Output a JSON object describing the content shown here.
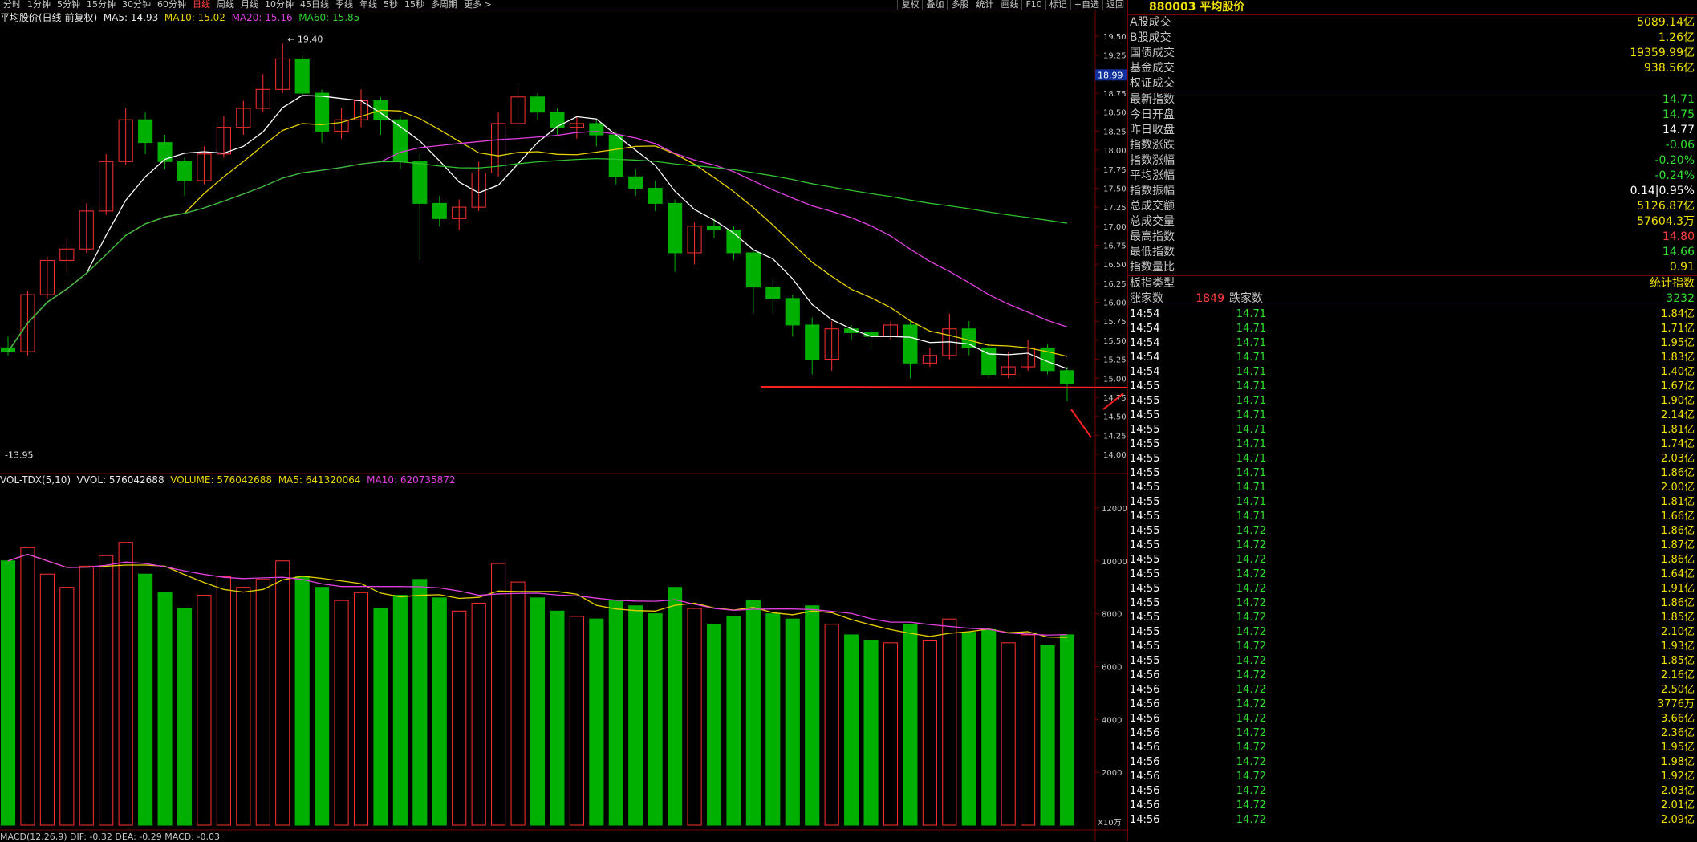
{
  "toolbar": {
    "periods": [
      "分时",
      "1分钟",
      "5分钟",
      "15分钟",
      "30分钟",
      "60分钟",
      "日线",
      "周线",
      "月线",
      "10分钟",
      "45日线",
      "季线",
      "年线",
      "5秒",
      "15秒",
      "多周期",
      "更多 >"
    ],
    "active_period": "日线",
    "tools": [
      "复权",
      "叠加",
      "多股",
      "统计",
      "画线",
      "F10",
      "标记",
      "+自选",
      "返回"
    ]
  },
  "main_chart": {
    "title": "平均股价(日线 前复权)",
    "ma5": "MA5: 14.93",
    "ma10": "MA10: 15.02",
    "ma20": "MA20: 15.16",
    "ma60": "MA60: 15.85",
    "price_axis": [
      "19.50",
      "19.25",
      "19.00",
      "18.75",
      "18.50",
      "18.25",
      "18.00",
      "17.75",
      "17.50",
      "17.25",
      "17.00",
      "16.75",
      "16.50",
      "16.25",
      "16.00",
      "15.75",
      "15.50",
      "15.25",
      "15.00",
      "14.75",
      "14.50",
      "14.25",
      "14.00"
    ],
    "high_label": "19.40",
    "low_label": "13.95",
    "current_tag": "18.99"
  },
  "volume_chart": {
    "legend_name": "VOL-TDX(5,10)",
    "vvol": "VVOL: 576042688",
    "volume": "VOLUME: 576042688",
    "ma5": "MA5: 641320064",
    "ma10": "MA10: 620735872",
    "axis": [
      "12000",
      "10000",
      "8000",
      "6000",
      "4000",
      "2000"
    ],
    "unit": "X10万"
  },
  "macd_legend": "MACD(12,26,9) DIF: -0.32 DEA: -0.29 MACD: -0.03",
  "colors": {
    "up": "#ff3030",
    "down": "#00b000",
    "ma5": "#ffffff",
    "ma10": "#e6d000",
    "ma20": "#e040e0",
    "ma60": "#30c030",
    "grid": "#7a0000"
  },
  "quote_panel": {
    "title": "880003 平均股价",
    "rows1": [
      {
        "label": "A股成交",
        "value": "5089.14亿"
      },
      {
        "label": "B股成交",
        "value": "1.26亿"
      },
      {
        "label": "国债成交",
        "value": "19359.99亿"
      },
      {
        "label": "基金成交",
        "value": "938.56亿"
      },
      {
        "label": "权证成交",
        "value": ""
      }
    ],
    "rows2": [
      {
        "label": "最新指数",
        "value": "14.71",
        "cls": "green"
      },
      {
        "label": "今日开盘",
        "value": "14.75",
        "cls": "green"
      },
      {
        "label": "昨日收盘",
        "value": "14.77",
        "cls": "white"
      },
      {
        "label": "指数涨跌",
        "value": "-0.06",
        "cls": "green"
      },
      {
        "label": "指数涨幅",
        "value": "-0.20%",
        "cls": "green"
      },
      {
        "label": "平均涨幅",
        "value": "-0.24%",
        "cls": "green"
      },
      {
        "label": "指数振幅",
        "value": "0.14|0.95%",
        "cls": "white"
      },
      {
        "label": "总成交额",
        "value": "5126.87亿"
      },
      {
        "label": "总成交量",
        "value": "57604.3万"
      },
      {
        "label": "最高指数",
        "value": "14.80",
        "cls": "red"
      },
      {
        "label": "最低指数",
        "value": "14.66",
        "cls": "green"
      },
      {
        "label": "指数量比",
        "value": "0.91"
      }
    ],
    "type_label": "板指类型",
    "type_value": "统计指数",
    "up_label": "涨家数",
    "up_value": "1849",
    "down_label": "跌家数",
    "down_value": "3232",
    "ticks": [
      {
        "t": "14:54",
        "p": "14.71",
        "v": "1.84亿"
      },
      {
        "t": "14:54",
        "p": "14.71",
        "v": "1.71亿"
      },
      {
        "t": "14:54",
        "p": "14.71",
        "v": "1.95亿"
      },
      {
        "t": "14:54",
        "p": "14.71",
        "v": "1.83亿"
      },
      {
        "t": "14:54",
        "p": "14.71",
        "v": "1.40亿"
      },
      {
        "t": "14:55",
        "p": "14.71",
        "v": "1.67亿"
      },
      {
        "t": "14:55",
        "p": "14.71",
        "v": "1.90亿"
      },
      {
        "t": "14:55",
        "p": "14.71",
        "v": "2.14亿"
      },
      {
        "t": "14:55",
        "p": "14.71",
        "v": "1.81亿"
      },
      {
        "t": "14:55",
        "p": "14.71",
        "v": "1.74亿"
      },
      {
        "t": "14:55",
        "p": "14.71",
        "v": "2.03亿"
      },
      {
        "t": "14:55",
        "p": "14.71",
        "v": "1.86亿"
      },
      {
        "t": "14:55",
        "p": "14.71",
        "v": "2.00亿"
      },
      {
        "t": "14:55",
        "p": "14.71",
        "v": "1.81亿"
      },
      {
        "t": "14:55",
        "p": "14.71",
        "v": "1.66亿"
      },
      {
        "t": "14:55",
        "p": "14.72",
        "v": "1.86亿"
      },
      {
        "t": "14:55",
        "p": "14.72",
        "v": "1.87亿"
      },
      {
        "t": "14:55",
        "p": "14.72",
        "v": "1.86亿"
      },
      {
        "t": "14:55",
        "p": "14.72",
        "v": "1.64亿"
      },
      {
        "t": "14:55",
        "p": "14.72",
        "v": "1.91亿"
      },
      {
        "t": "14:55",
        "p": "14.72",
        "v": "1.86亿"
      },
      {
        "t": "14:55",
        "p": "14.72",
        "v": "1.85亿"
      },
      {
        "t": "14:55",
        "p": "14.72",
        "v": "2.10亿"
      },
      {
        "t": "14:55",
        "p": "14.72",
        "v": "1.93亿"
      },
      {
        "t": "14:55",
        "p": "14.72",
        "v": "1.85亿"
      },
      {
        "t": "14:56",
        "p": "14.72",
        "v": "2.16亿"
      },
      {
        "t": "14:56",
        "p": "14.72",
        "v": "2.50亿"
      },
      {
        "t": "14:56",
        "p": "14.72",
        "v": "3776万"
      },
      {
        "t": "14:56",
        "p": "14.72",
        "v": "3.66亿"
      },
      {
        "t": "14:56",
        "p": "14.72",
        "v": "2.36亿"
      },
      {
        "t": "14:56",
        "p": "14.72",
        "v": "1.95亿"
      },
      {
        "t": "14:56",
        "p": "14.72",
        "v": "1.98亿"
      },
      {
        "t": "14:56",
        "p": "14.72",
        "v": "1.92亿"
      },
      {
        "t": "14:56",
        "p": "14.72",
        "v": "2.03亿"
      },
      {
        "t": "14:56",
        "p": "14.72",
        "v": "2.01亿"
      },
      {
        "t": "14:56",
        "p": "14.72",
        "v": "2.09亿"
      }
    ]
  },
  "candles": [
    [
      15.4,
      15.35,
      15.55,
      15.3,
      1000
    ],
    [
      15.35,
      16.1,
      16.15,
      15.3,
      1050
    ],
    [
      16.1,
      16.55,
      16.6,
      16.05,
      950
    ],
    [
      16.55,
      16.7,
      16.85,
      16.4,
      900
    ],
    [
      16.7,
      17.2,
      17.3,
      16.65,
      980
    ],
    [
      17.2,
      17.85,
      17.95,
      17.15,
      1020
    ],
    [
      17.85,
      18.4,
      18.55,
      17.8,
      1070
    ],
    [
      18.4,
      18.1,
      18.5,
      17.95,
      950
    ],
    [
      18.1,
      17.85,
      18.2,
      17.75,
      880
    ],
    [
      17.85,
      17.6,
      17.9,
      17.4,
      820
    ],
    [
      17.6,
      17.95,
      18.05,
      17.55,
      870
    ],
    [
      17.95,
      18.3,
      18.45,
      17.9,
      940
    ],
    [
      18.3,
      18.55,
      18.65,
      18.2,
      900
    ],
    [
      18.55,
      18.8,
      19.0,
      18.5,
      930
    ],
    [
      18.8,
      19.2,
      19.4,
      18.75,
      1000
    ],
    [
      19.2,
      18.75,
      19.25,
      18.7,
      940
    ],
    [
      18.75,
      18.25,
      18.8,
      18.1,
      900
    ],
    [
      18.25,
      18.4,
      18.55,
      18.15,
      850
    ],
    [
      18.4,
      18.65,
      18.8,
      18.3,
      880
    ],
    [
      18.65,
      18.4,
      18.7,
      18.2,
      820
    ],
    [
      18.4,
      17.85,
      18.45,
      17.75,
      870
    ],
    [
      17.85,
      17.3,
      17.95,
      16.55,
      930
    ],
    [
      17.3,
      17.1,
      17.4,
      17.0,
      860
    ],
    [
      17.1,
      17.25,
      17.35,
      16.95,
      810
    ],
    [
      17.25,
      17.7,
      17.85,
      17.2,
      840
    ],
    [
      17.7,
      18.35,
      18.5,
      17.65,
      990
    ],
    [
      18.35,
      18.7,
      18.8,
      18.25,
      920
    ],
    [
      18.7,
      18.5,
      18.75,
      18.4,
      860
    ],
    [
      18.5,
      18.3,
      18.55,
      18.2,
      810
    ],
    [
      18.3,
      18.35,
      18.45,
      18.15,
      790
    ],
    [
      18.35,
      18.2,
      18.4,
      18.05,
      780
    ],
    [
      18.2,
      17.65,
      18.25,
      17.55,
      850
    ],
    [
      17.65,
      17.5,
      17.75,
      17.4,
      830
    ],
    [
      17.5,
      17.3,
      17.6,
      17.2,
      800
    ],
    [
      17.3,
      16.65,
      17.35,
      16.4,
      900
    ],
    [
      16.65,
      17.0,
      17.05,
      16.5,
      820
    ],
    [
      17.0,
      16.95,
      17.1,
      16.85,
      760
    ],
    [
      16.95,
      16.65,
      17.0,
      16.55,
      790
    ],
    [
      16.65,
      16.2,
      16.7,
      15.85,
      850
    ],
    [
      16.2,
      16.05,
      16.3,
      15.85,
      800
    ],
    [
      16.05,
      15.7,
      16.1,
      15.55,
      780
    ],
    [
      15.7,
      15.25,
      15.8,
      15.05,
      830
    ],
    [
      15.25,
      15.65,
      15.75,
      15.1,
      760
    ],
    [
      15.65,
      15.6,
      15.7,
      15.5,
      720
    ],
    [
      15.6,
      15.55,
      15.65,
      15.4,
      700
    ],
    [
      15.55,
      15.7,
      15.75,
      15.5,
      690
    ],
    [
      15.7,
      15.2,
      15.75,
      15.0,
      760
    ],
    [
      15.2,
      15.3,
      15.4,
      15.15,
      700
    ],
    [
      15.3,
      15.65,
      15.85,
      15.25,
      780
    ],
    [
      15.65,
      15.4,
      15.75,
      15.3,
      730
    ],
    [
      15.4,
      15.05,
      15.45,
      15.0,
      740
    ],
    [
      15.05,
      15.15,
      15.35,
      15.0,
      690
    ],
    [
      15.15,
      15.4,
      15.5,
      15.1,
      720
    ],
    [
      15.4,
      15.1,
      15.45,
      15.05,
      680
    ],
    [
      15.1,
      14.93,
      15.15,
      14.7,
      720
    ]
  ]
}
